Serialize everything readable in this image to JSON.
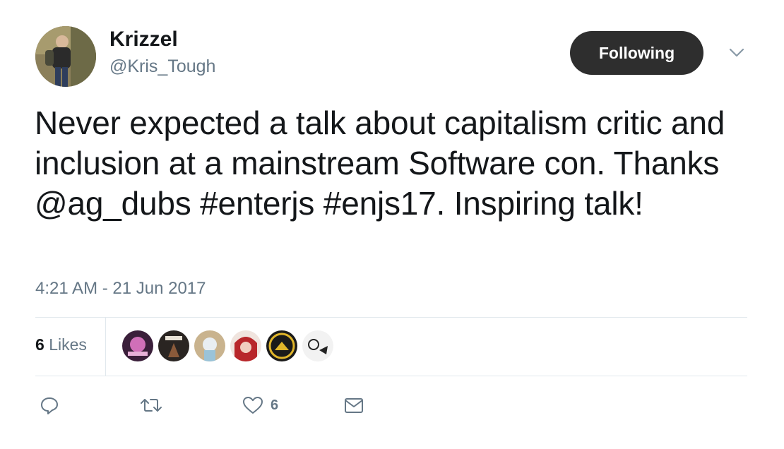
{
  "author": {
    "name": "Krizzel",
    "handle": "@Kris_Tough",
    "avatar": "avatar"
  },
  "follow_button": {
    "label": "Following"
  },
  "menu": {
    "icon": "chevron-down-icon"
  },
  "tweet": {
    "text": "Never expected a talk about capitalism critic and inclusion at a mainstream Software con. Thanks @ag_dubs #enterjs #enjs17. Inspiring talk!",
    "timestamp": "4:21 AM - 21 Jun 2017"
  },
  "stats": {
    "likes_count": "6",
    "likes_label": "Likes"
  },
  "likers": [
    {
      "name": "liker-1",
      "color": "#3a1f3a"
    },
    {
      "name": "liker-2",
      "color": "#2a2522"
    },
    {
      "name": "liker-3",
      "color": "#c9b38e"
    },
    {
      "name": "liker-4",
      "color": "#b8262a"
    },
    {
      "name": "liker-5",
      "color": "#1a1a1a"
    },
    {
      "name": "liker-6",
      "color": "#f2f2f2"
    }
  ],
  "actions": {
    "reply_icon": "reply-icon",
    "retweet_icon": "retweet-icon",
    "like_icon": "heart-icon",
    "like_count": "6",
    "dm_icon": "envelope-icon"
  },
  "colors": {
    "text": "#14171a",
    "muted": "#657786",
    "button": "#2e2e2e",
    "divider": "#e1e8ed"
  }
}
